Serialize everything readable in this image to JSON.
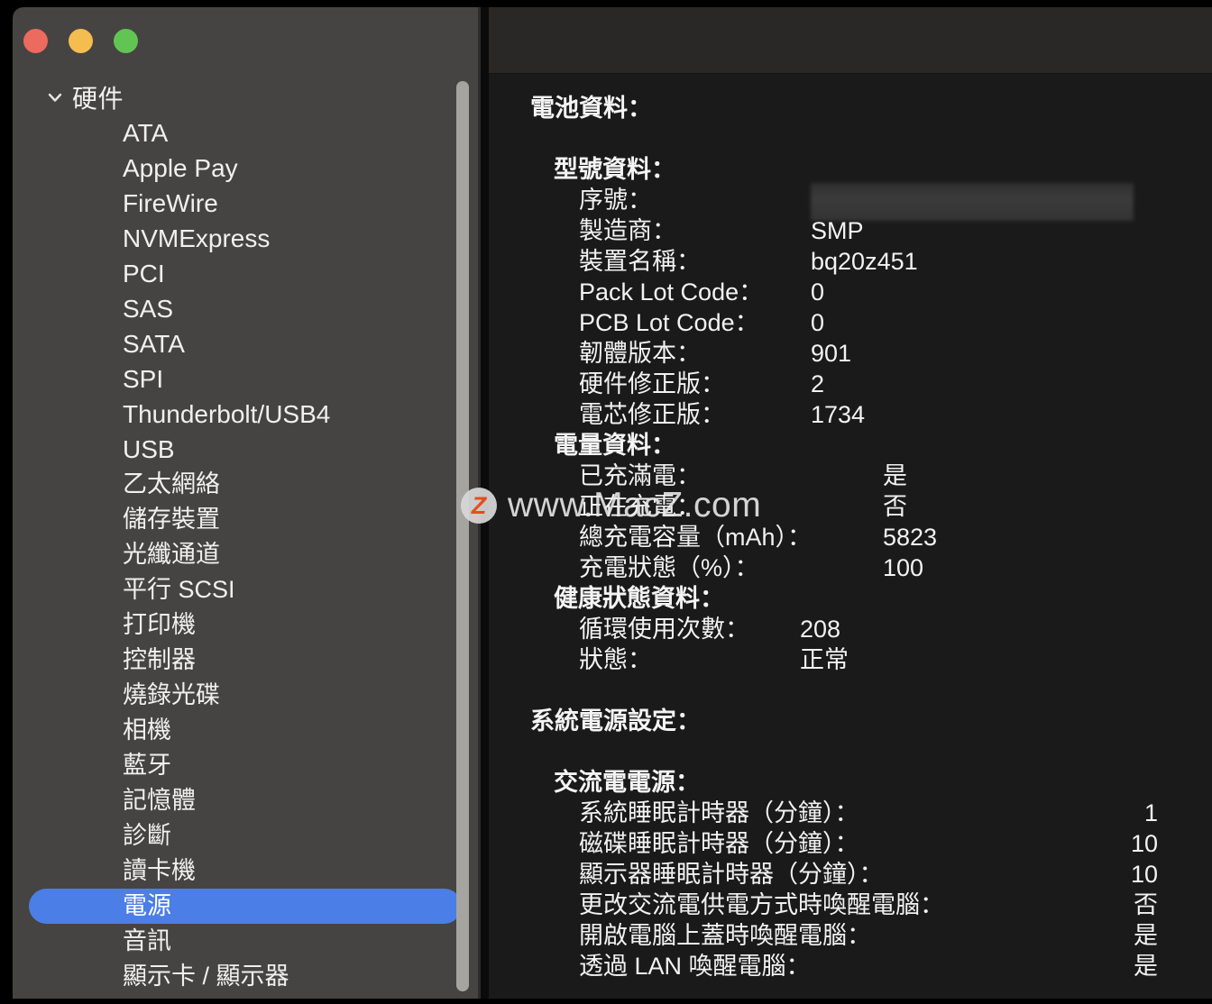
{
  "window": {
    "traffic_lights": [
      {
        "name": "close",
        "color": "#ec6a5e"
      },
      {
        "name": "minimize",
        "color": "#f4bd4f"
      },
      {
        "name": "zoom",
        "color": "#61c554"
      }
    ],
    "accent_color": "#4b7ee6",
    "sidebar_bg": "#464442",
    "content_bg": "#1a1a1a"
  },
  "sidebar": {
    "group": {
      "label": "硬件",
      "expanded": true,
      "icon": "chevron-down-icon"
    },
    "items": [
      {
        "label": "ATA",
        "latin": true,
        "selected": false
      },
      {
        "label": "Apple Pay",
        "latin": true,
        "selected": false
      },
      {
        "label": "FireWire",
        "latin": true,
        "selected": false
      },
      {
        "label": "NVMExpress",
        "latin": true,
        "selected": false
      },
      {
        "label": "PCI",
        "latin": true,
        "selected": false
      },
      {
        "label": "SAS",
        "latin": true,
        "selected": false
      },
      {
        "label": "SATA",
        "latin": true,
        "selected": false
      },
      {
        "label": "SPI",
        "latin": true,
        "selected": false
      },
      {
        "label": "Thunderbolt/USB4",
        "latin": true,
        "selected": false
      },
      {
        "label": "USB",
        "latin": true,
        "selected": false
      },
      {
        "label": "乙太網絡",
        "latin": false,
        "selected": false
      },
      {
        "label": "儲存裝置",
        "latin": false,
        "selected": false
      },
      {
        "label": "光纖通道",
        "latin": false,
        "selected": false
      },
      {
        "label": "平行 SCSI",
        "latin": false,
        "selected": false
      },
      {
        "label": "打印機",
        "latin": false,
        "selected": false
      },
      {
        "label": "控制器",
        "latin": false,
        "selected": false
      },
      {
        "label": "燒錄光碟",
        "latin": false,
        "selected": false
      },
      {
        "label": "相機",
        "latin": false,
        "selected": false
      },
      {
        "label": "藍牙",
        "latin": false,
        "selected": false
      },
      {
        "label": "記憶體",
        "latin": false,
        "selected": false
      },
      {
        "label": "診斷",
        "latin": false,
        "selected": false
      },
      {
        "label": "讀卡機",
        "latin": false,
        "selected": false
      },
      {
        "label": "電源",
        "latin": false,
        "selected": true
      },
      {
        "label": "音訊",
        "latin": false,
        "selected": false
      },
      {
        "label": "顯示卡 / 顯示器",
        "latin": false,
        "selected": false
      }
    ]
  },
  "content": {
    "battery": {
      "title": "電池資料：",
      "model_group": {
        "title": "型號資料：",
        "rows": [
          {
            "key": "序號：",
            "value": "",
            "redacted": true
          },
          {
            "key": "製造商：",
            "value": "SMP"
          },
          {
            "key": "裝置名稱：",
            "value": "bq20z451"
          },
          {
            "key": "Pack Lot Code：",
            "value": "0"
          },
          {
            "key": "PCB Lot Code：",
            "value": "0"
          },
          {
            "key": "韌體版本：",
            "value": "901"
          },
          {
            "key": "硬件修正版：",
            "value": "2"
          },
          {
            "key": "電芯修正版：",
            "value": "1734"
          }
        ]
      },
      "charge_group": {
        "title": "電量資料：",
        "rows": [
          {
            "key": "已充滿電：",
            "value": "是"
          },
          {
            "key": "正在充電：",
            "value": "否"
          },
          {
            "key": "總充電容量（mAh）：",
            "value": "5823"
          },
          {
            "key": "充電狀態（%）：",
            "value": "100"
          }
        ]
      },
      "health_group": {
        "title": "健康狀態資料：",
        "rows": [
          {
            "key": "循環使用次數：",
            "value": "208"
          },
          {
            "key": "狀態：",
            "value": "正常"
          }
        ]
      }
    },
    "power_settings": {
      "title": "系統電源設定：",
      "ac_group": {
        "title": "交流電電源：",
        "rows": [
          {
            "key": "系統睡眠計時器（分鐘）：",
            "value": "1"
          },
          {
            "key": "磁碟睡眠計時器（分鐘）：",
            "value": "10"
          },
          {
            "key": "顯示器睡眠計時器（分鐘）：",
            "value": "10"
          },
          {
            "key": "更改交流電供電方式時喚醒電腦：",
            "value": "否"
          },
          {
            "key": "開啟電腦上蓋時喚醒電腦：",
            "value": "是"
          },
          {
            "key": "透過 LAN 喚醒電腦：",
            "value": "是"
          }
        ]
      }
    }
  },
  "watermark": {
    "badge": "Z",
    "text": "www.MacZ.com"
  }
}
